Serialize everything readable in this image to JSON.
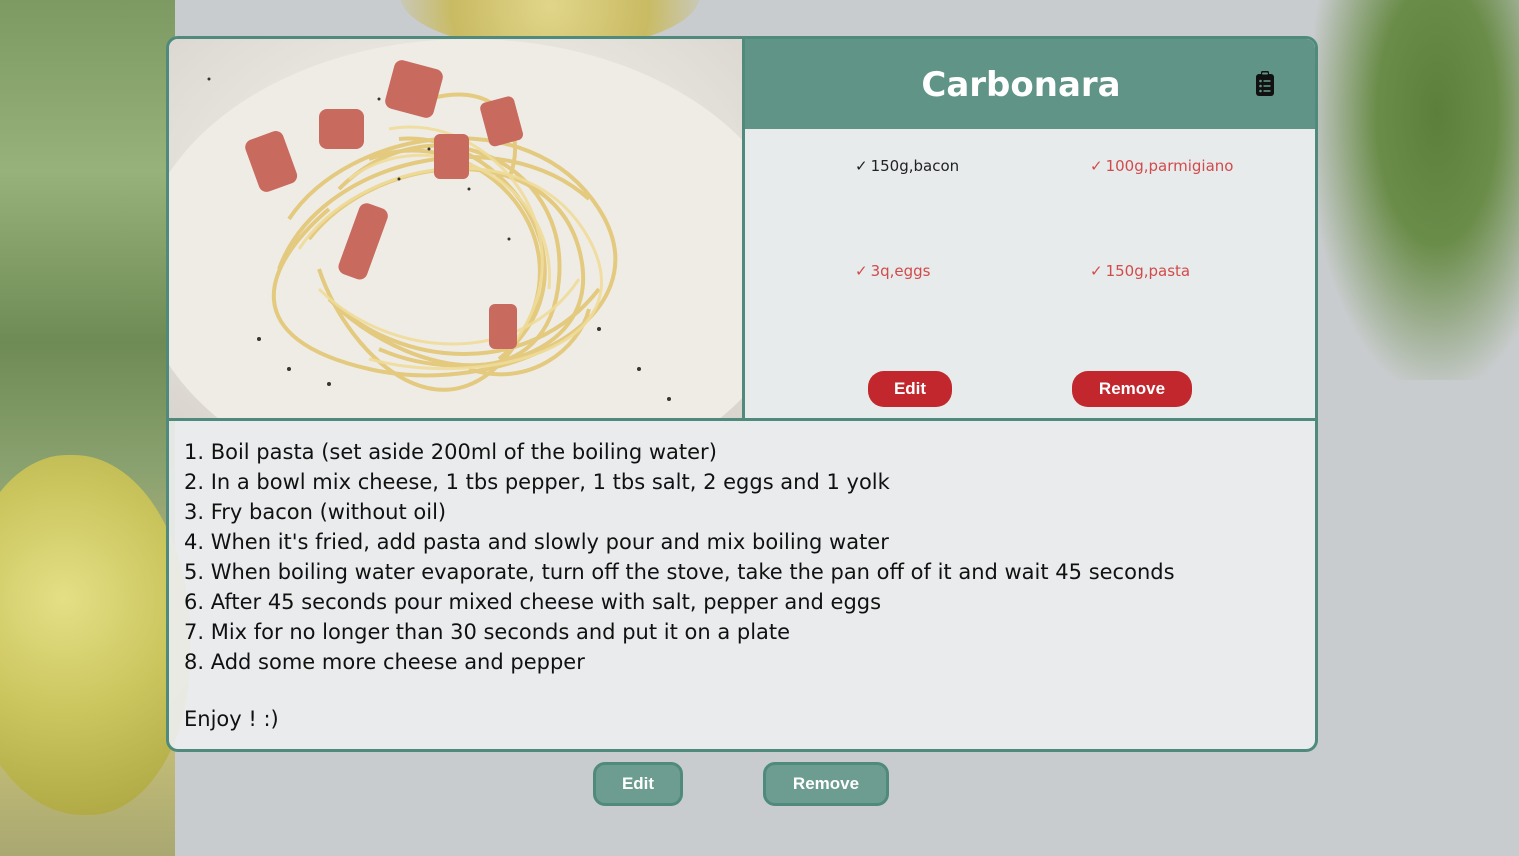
{
  "recipe": {
    "title": "Carbonara",
    "ingredients": [
      {
        "text": "150g,bacon",
        "checked": true,
        "highlight": false
      },
      {
        "text": "100g,parmigiano",
        "checked": true,
        "highlight": true
      },
      {
        "text": "3q,eggs",
        "checked": true,
        "highlight": true
      },
      {
        "text": "150g,pasta",
        "checked": true,
        "highlight": true
      }
    ],
    "check_mark": "✓",
    "card_buttons": {
      "edit": "Edit",
      "remove": "Remove"
    },
    "steps": [
      "1. Boil pasta (set aside 200ml of the boiling water)",
      "2. In a bowl mix cheese, 1 tbs pepper, 1 tbs salt, 2 eggs and 1 yolk",
      "3. Fry bacon (without oil)",
      "4. When it's fried, add pasta and slowly pour and mix boiling water",
      "5. When boiling water evaporate, turn off the stove, take the pan off of it and wait 45 seconds",
      "6. After 45 seconds pour mixed cheese with salt, pepper and eggs",
      "7. Mix for no longer than 30 seconds and put it on a plate",
      "8. Add some more cheese and pepper"
    ],
    "closing": "Enjoy ! :)"
  },
  "bottom_buttons": {
    "edit": "Edit",
    "remove": "Remove"
  },
  "icons": {
    "clipboard": "clipboard-list-icon"
  },
  "colors": {
    "accent": "#4f8a7c",
    "header": "#5f9486",
    "danger": "#c1272d",
    "ingredient_highlight": "#d24b4b"
  }
}
